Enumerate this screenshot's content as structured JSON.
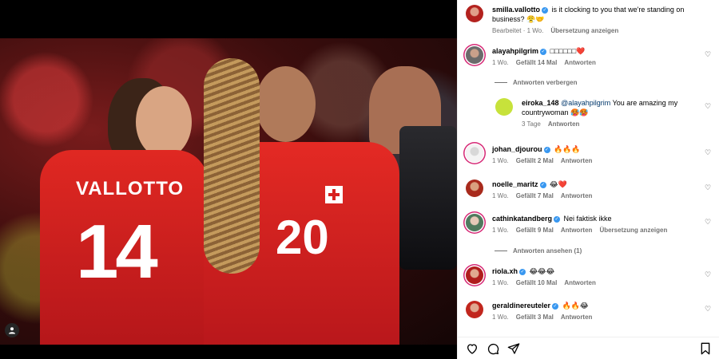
{
  "post": {
    "caption_user": "smilla.vallotto",
    "caption_text": "is it clocking to you that we're standing on business? 😤🤝",
    "edited": "Bearbeitet",
    "age": "1 Wo.",
    "translate": "Übersetzung anzeigen"
  },
  "media": {
    "jersey_name": "VALLOTTO",
    "number_left": "14",
    "number_right": "20",
    "user_tag_icon": "person-icon"
  },
  "comments": [
    {
      "user": "alayahpilgrim",
      "text": "□□□□□□❤️",
      "age": "1 Wo.",
      "likes": "Gefällt 14 Mal",
      "reply": "Antworten"
    },
    {
      "user": "eiroka_148",
      "mention": "@alayahpilgrim",
      "text": "You are amazing my countrywoman 🥵🥵",
      "age": "3 Tage",
      "reply": "Antworten"
    },
    {
      "user": "johan_djourou",
      "text": "🔥🔥🔥",
      "age": "1 Wo.",
      "likes": "Gefällt 2 Mal",
      "reply": "Antworten"
    },
    {
      "user": "noelle_maritz",
      "text": "😂❤️",
      "age": "1 Wo.",
      "likes": "Gefällt 7 Mal",
      "reply": "Antworten"
    },
    {
      "user": "cathinkatandberg",
      "text": "Nei faktisk ikke",
      "age": "1 Wo.",
      "likes": "Gefällt 9 Mal",
      "reply": "Antworten",
      "translate": "Übersetzung anzeigen"
    },
    {
      "user": "riola.xh",
      "text": "😂😂😂",
      "age": "1 Wo.",
      "likes": "Gefällt 10 Mal",
      "reply": "Antworten"
    },
    {
      "user": "geraldinereuteler",
      "text": "🔥🔥😂",
      "age": "1 Wo.",
      "likes": "Gefällt 3 Mal",
      "reply": "Antworten"
    }
  ],
  "threads": {
    "hide_replies": "Antworten verbergen",
    "view_replies": "Antworten ansehen (1)"
  },
  "actions": {
    "like_icon": "heart-icon",
    "comment_icon": "comment-icon",
    "share_icon": "send-icon",
    "save_icon": "bookmark-icon"
  }
}
